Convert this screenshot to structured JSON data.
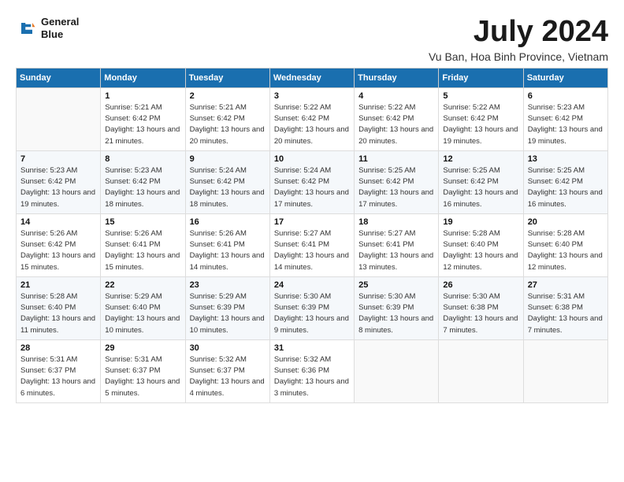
{
  "header": {
    "logo_line1": "General",
    "logo_line2": "Blue",
    "month_title": "July 2024",
    "location": "Vu Ban, Hoa Binh Province, Vietnam"
  },
  "columns": [
    "Sunday",
    "Monday",
    "Tuesday",
    "Wednesday",
    "Thursday",
    "Friday",
    "Saturday"
  ],
  "weeks": [
    [
      {
        "day": "",
        "sunrise": "",
        "sunset": "",
        "daylight": ""
      },
      {
        "day": "1",
        "sunrise": "5:21 AM",
        "sunset": "6:42 PM",
        "daylight": "13 hours and 21 minutes."
      },
      {
        "day": "2",
        "sunrise": "5:21 AM",
        "sunset": "6:42 PM",
        "daylight": "13 hours and 20 minutes."
      },
      {
        "day": "3",
        "sunrise": "5:22 AM",
        "sunset": "6:42 PM",
        "daylight": "13 hours and 20 minutes."
      },
      {
        "day": "4",
        "sunrise": "5:22 AM",
        "sunset": "6:42 PM",
        "daylight": "13 hours and 20 minutes."
      },
      {
        "day": "5",
        "sunrise": "5:22 AM",
        "sunset": "6:42 PM",
        "daylight": "13 hours and 19 minutes."
      },
      {
        "day": "6",
        "sunrise": "5:23 AM",
        "sunset": "6:42 PM",
        "daylight": "13 hours and 19 minutes."
      }
    ],
    [
      {
        "day": "7",
        "sunrise": "5:23 AM",
        "sunset": "6:42 PM",
        "daylight": "13 hours and 19 minutes."
      },
      {
        "day": "8",
        "sunrise": "5:23 AM",
        "sunset": "6:42 PM",
        "daylight": "13 hours and 18 minutes."
      },
      {
        "day": "9",
        "sunrise": "5:24 AM",
        "sunset": "6:42 PM",
        "daylight": "13 hours and 18 minutes."
      },
      {
        "day": "10",
        "sunrise": "5:24 AM",
        "sunset": "6:42 PM",
        "daylight": "13 hours and 17 minutes."
      },
      {
        "day": "11",
        "sunrise": "5:25 AM",
        "sunset": "6:42 PM",
        "daylight": "13 hours and 17 minutes."
      },
      {
        "day": "12",
        "sunrise": "5:25 AM",
        "sunset": "6:42 PM",
        "daylight": "13 hours and 16 minutes."
      },
      {
        "day": "13",
        "sunrise": "5:25 AM",
        "sunset": "6:42 PM",
        "daylight": "13 hours and 16 minutes."
      }
    ],
    [
      {
        "day": "14",
        "sunrise": "5:26 AM",
        "sunset": "6:42 PM",
        "daylight": "13 hours and 15 minutes."
      },
      {
        "day": "15",
        "sunrise": "5:26 AM",
        "sunset": "6:41 PM",
        "daylight": "13 hours and 15 minutes."
      },
      {
        "day": "16",
        "sunrise": "5:26 AM",
        "sunset": "6:41 PM",
        "daylight": "13 hours and 14 minutes."
      },
      {
        "day": "17",
        "sunrise": "5:27 AM",
        "sunset": "6:41 PM",
        "daylight": "13 hours and 14 minutes."
      },
      {
        "day": "18",
        "sunrise": "5:27 AM",
        "sunset": "6:41 PM",
        "daylight": "13 hours and 13 minutes."
      },
      {
        "day": "19",
        "sunrise": "5:28 AM",
        "sunset": "6:40 PM",
        "daylight": "13 hours and 12 minutes."
      },
      {
        "day": "20",
        "sunrise": "5:28 AM",
        "sunset": "6:40 PM",
        "daylight": "13 hours and 12 minutes."
      }
    ],
    [
      {
        "day": "21",
        "sunrise": "5:28 AM",
        "sunset": "6:40 PM",
        "daylight": "13 hours and 11 minutes."
      },
      {
        "day": "22",
        "sunrise": "5:29 AM",
        "sunset": "6:40 PM",
        "daylight": "13 hours and 10 minutes."
      },
      {
        "day": "23",
        "sunrise": "5:29 AM",
        "sunset": "6:39 PM",
        "daylight": "13 hours and 10 minutes."
      },
      {
        "day": "24",
        "sunrise": "5:30 AM",
        "sunset": "6:39 PM",
        "daylight": "13 hours and 9 minutes."
      },
      {
        "day": "25",
        "sunrise": "5:30 AM",
        "sunset": "6:39 PM",
        "daylight": "13 hours and 8 minutes."
      },
      {
        "day": "26",
        "sunrise": "5:30 AM",
        "sunset": "6:38 PM",
        "daylight": "13 hours and 7 minutes."
      },
      {
        "day": "27",
        "sunrise": "5:31 AM",
        "sunset": "6:38 PM",
        "daylight": "13 hours and 7 minutes."
      }
    ],
    [
      {
        "day": "28",
        "sunrise": "5:31 AM",
        "sunset": "6:37 PM",
        "daylight": "13 hours and 6 minutes."
      },
      {
        "day": "29",
        "sunrise": "5:31 AM",
        "sunset": "6:37 PM",
        "daylight": "13 hours and 5 minutes."
      },
      {
        "day": "30",
        "sunrise": "5:32 AM",
        "sunset": "6:37 PM",
        "daylight": "13 hours and 4 minutes."
      },
      {
        "day": "31",
        "sunrise": "5:32 AM",
        "sunset": "6:36 PM",
        "daylight": "13 hours and 3 minutes."
      },
      {
        "day": "",
        "sunrise": "",
        "sunset": "",
        "daylight": ""
      },
      {
        "day": "",
        "sunrise": "",
        "sunset": "",
        "daylight": ""
      },
      {
        "day": "",
        "sunrise": "",
        "sunset": "",
        "daylight": ""
      }
    ]
  ]
}
